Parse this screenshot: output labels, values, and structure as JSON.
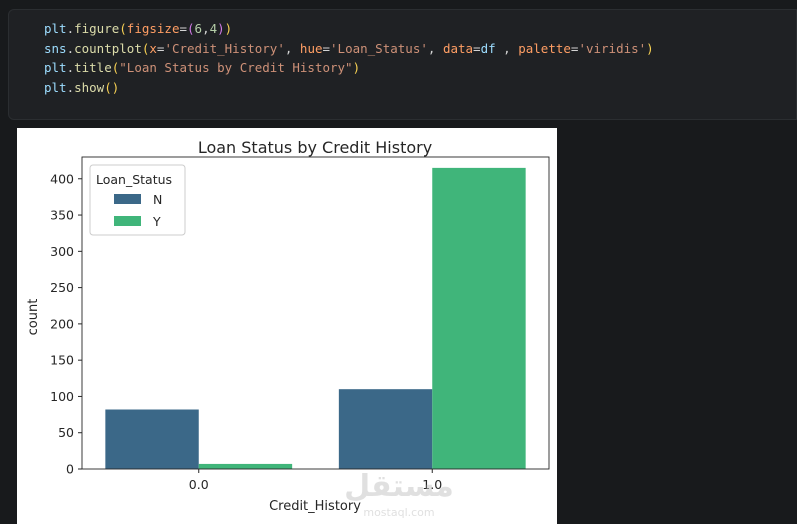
{
  "code_cell": {
    "lines": [
      "plt.figure(figsize=(6,4))",
      "sns.countplot(x='Credit_History', hue='Loan_Status', data=df , palette='viridis')",
      "plt.title(\"Loan Status by Credit History\")",
      "plt.show()"
    ]
  },
  "watermark": {
    "text": "mostaql.com",
    "arabic": "مستقل"
  },
  "chart_data": {
    "type": "bar",
    "title": "Loan Status by Credit History",
    "xlabel": "Credit_History",
    "ylabel": "count",
    "categories": [
      "0.0",
      "1.0"
    ],
    "series": [
      {
        "name": "N",
        "values": [
          82,
          110
        ],
        "color": "#3b6888"
      },
      {
        "name": "Y",
        "values": [
          7,
          415
        ],
        "color": "#40b57a"
      }
    ],
    "ylim": [
      0,
      430
    ],
    "yticks": [
      0,
      50,
      100,
      150,
      200,
      250,
      300,
      350,
      400
    ],
    "legend": {
      "title": "Loan_Status",
      "placement": "top-left"
    },
    "grid": false
  }
}
